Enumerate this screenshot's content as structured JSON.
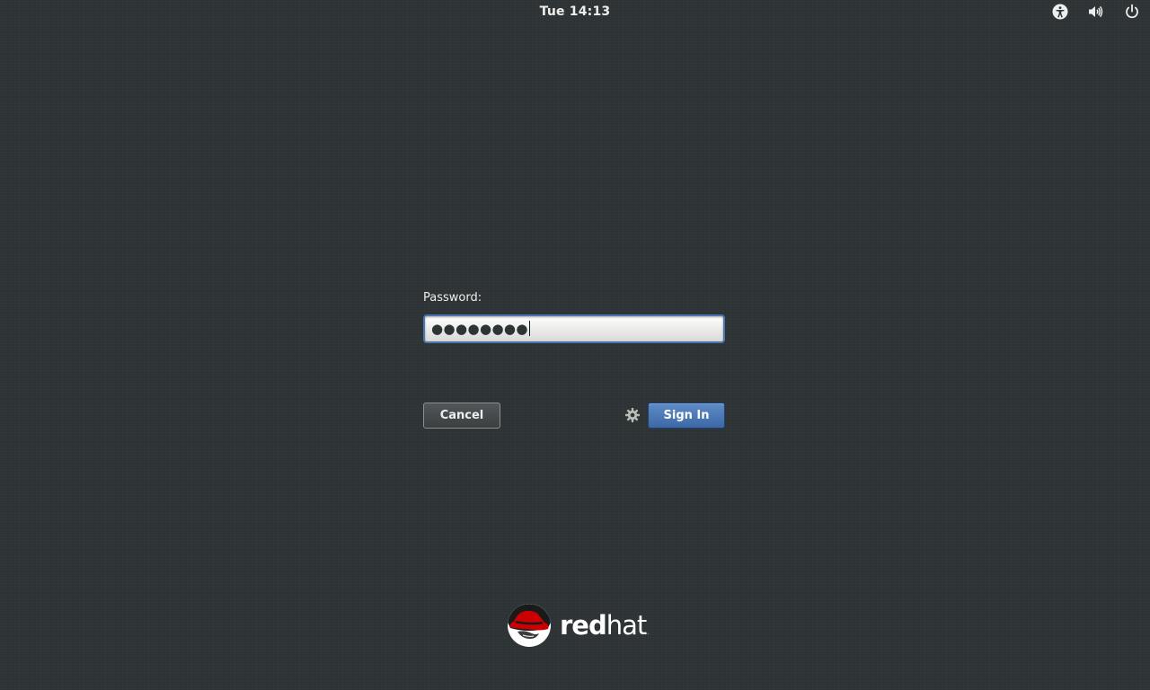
{
  "top_bar": {
    "clock": "Tue 14:13",
    "icons": [
      "accessibility-icon",
      "volume-icon",
      "power-icon"
    ]
  },
  "login": {
    "password_label": "Password:",
    "password_masked": "●●●●●●●●",
    "cancel_label": "Cancel",
    "sign_in_label": "Sign In",
    "session_icon": "gear-icon"
  },
  "branding": {
    "logo_text_bold": "red",
    "logo_text_light": "hat",
    "logo_trademark": "."
  },
  "colors": {
    "background": "#2e3436",
    "accent": "#4a77b0",
    "brand_red": "#cc0000",
    "text": "#eeeeec"
  }
}
